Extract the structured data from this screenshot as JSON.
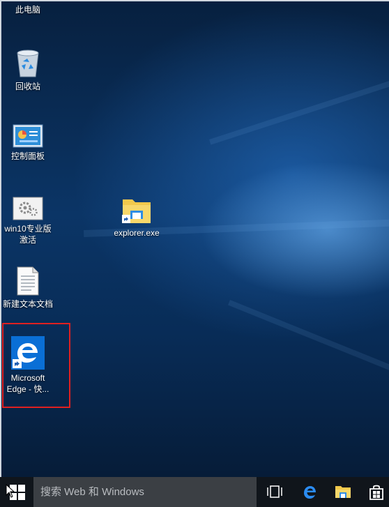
{
  "desktop": {
    "icons": [
      {
        "label": "此电脑"
      },
      {
        "label": "回收站"
      },
      {
        "label": "控制面板"
      },
      {
        "label_line1": "win10专业版",
        "label_line2": "激活"
      },
      {
        "label": "新建文本文档"
      },
      {
        "label_line1": "Microsoft",
        "label_line2": "Edge - 快..."
      },
      {
        "label": "explorer.exe"
      }
    ]
  },
  "taskbar": {
    "search_placeholder": "搜索 Web 和 Windows",
    "buttons": [
      "start-icon",
      "task-view-icon",
      "edge-icon",
      "file-explorer-icon",
      "store-icon"
    ]
  },
  "colors": {
    "edge_blue": "#0a6fd6",
    "selection_border": "#e02020",
    "taskbar": "#10151b"
  }
}
